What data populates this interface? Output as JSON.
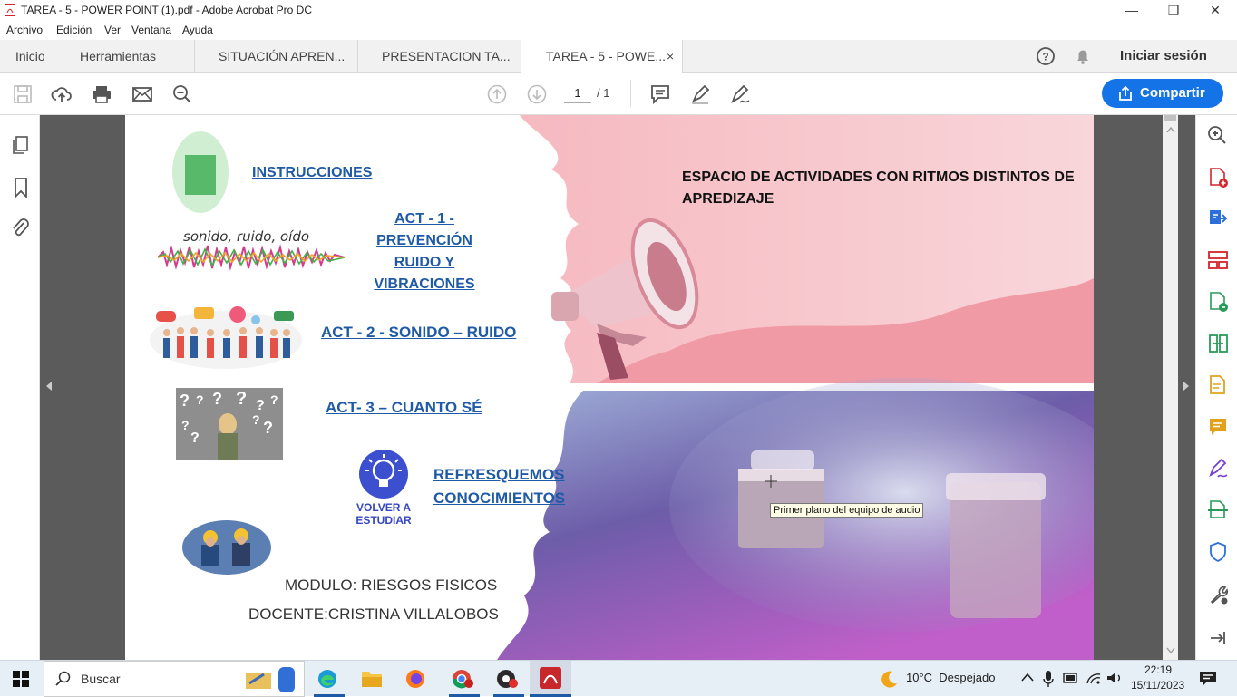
{
  "window": {
    "title": "TAREA - 5 - POWER POINT (1).pdf - Adobe Acrobat Pro DC",
    "minimize": "—",
    "maximize": "❐",
    "close": "✕"
  },
  "menu": [
    "Archivo",
    "Edición",
    "Ver",
    "Ventana",
    "Ayuda"
  ],
  "tabs": {
    "home": "Inicio",
    "tools": "Herramientas",
    "doc1": "SITUACIÓN APREN...",
    "doc2": "PRESENTACION TA...",
    "doc3": "TAREA - 5 - POWE...",
    "close": "×",
    "login": "Iniciar sesión"
  },
  "toolbar": {
    "page_current": "1",
    "page_total": "/ 1",
    "share": "Compartir"
  },
  "slide": {
    "instrucciones": "INSTRUCCIONES",
    "act1": [
      "ACT - 1 -",
      "PREVENCIÓN",
      "RUIDO Y",
      "VIBRACIONES"
    ],
    "act2": "ACT - 2 - SONIDO – RUIDO",
    "act3": "ACT- 3 – CUANTO SÉ",
    "refresh": [
      "REFRESQUEMOS",
      "CONOCIMIENTOS"
    ],
    "volver": [
      "VOLVER A",
      "ESTUDIAR"
    ],
    "sonido_text": "sonido, ruido, oído",
    "modulo": "MODULO: RIESGOS FISICOS",
    "docente": "DOCENTE:CRISTINA VILLALOBOS",
    "header": [
      "ESPACIO DE ACTIVIDADES CON RITMOS DISTINTOS DE",
      "APREDIZAJE"
    ],
    "tooltip": "Primer plano del equipo de audio"
  },
  "taskbar": {
    "search": "Buscar",
    "weather": "10°C  Despejado",
    "time": "22:19",
    "date": "15/11/2023"
  },
  "colors": {
    "accent": "#1473e6",
    "link": "#1f5aa6",
    "pink": "#f2a2ad",
    "acrobat_red": "#d4242b"
  }
}
